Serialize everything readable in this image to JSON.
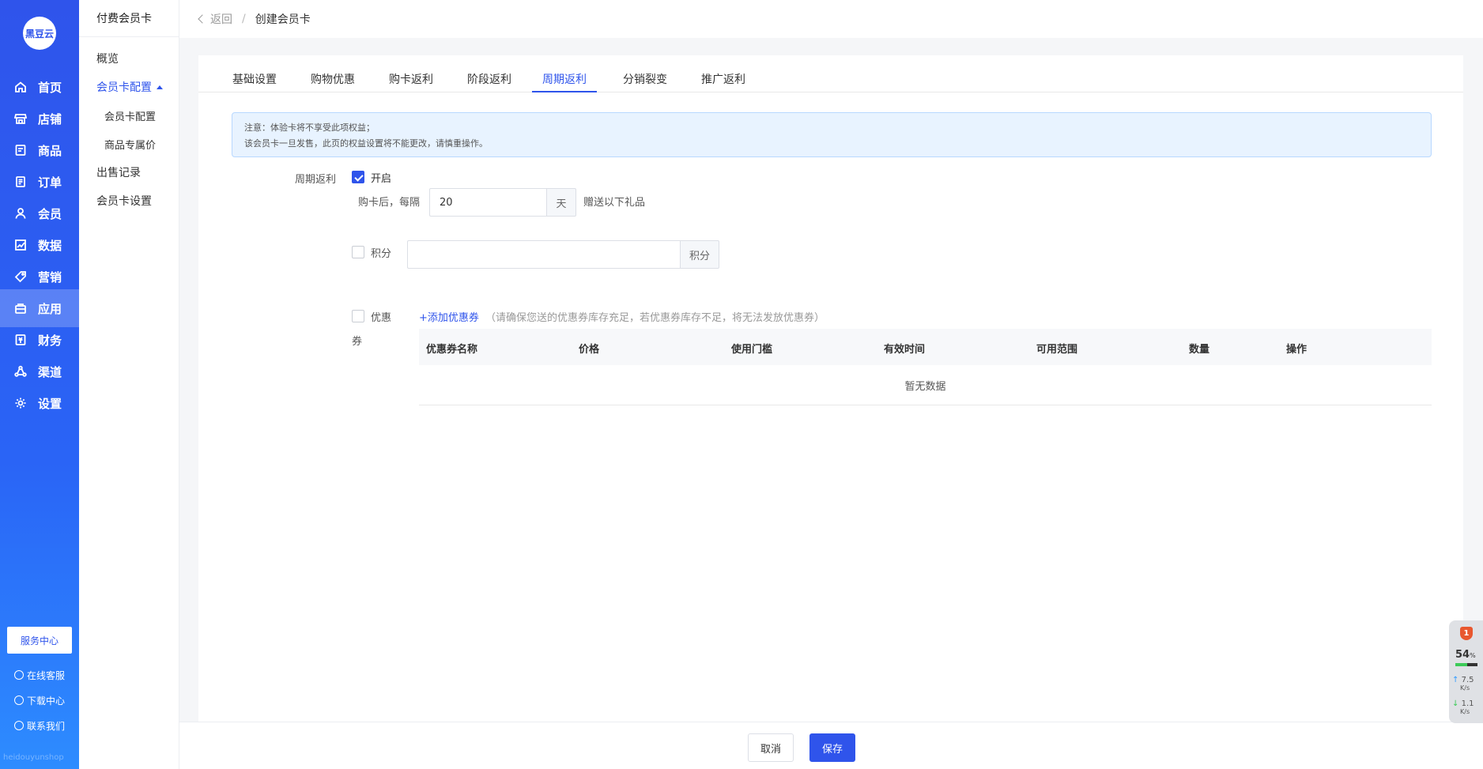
{
  "nav": {
    "logo": "黑豆云",
    "items": [
      {
        "label": "首页",
        "icon": "home-icon"
      },
      {
        "label": "店铺",
        "icon": "store-icon"
      },
      {
        "label": "商品",
        "icon": "goods-icon"
      },
      {
        "label": "订单",
        "icon": "order-icon"
      },
      {
        "label": "会员",
        "icon": "member-icon"
      },
      {
        "label": "数据",
        "icon": "chart-icon"
      },
      {
        "label": "营销",
        "icon": "tag-icon"
      },
      {
        "label": "应用",
        "icon": "app-icon"
      },
      {
        "label": "财务",
        "icon": "finance-icon"
      },
      {
        "label": "渠道",
        "icon": "channel-icon"
      },
      {
        "label": "设置",
        "icon": "gear-icon"
      }
    ],
    "active": "应用",
    "service_center": "服务中心",
    "links": [
      "在线客服",
      "下载中心",
      "联系我们"
    ],
    "footer": "heidouyunshop"
  },
  "submenu": {
    "title": "付费会员卡",
    "items": {
      "overview": "概览",
      "config_parent": "会员卡配置",
      "config_child": "会员卡配置",
      "exclusive_price": "商品专属价",
      "sales_record": "出售记录",
      "card_settings": "会员卡设置"
    }
  },
  "breadcrumb": {
    "back": "返回",
    "separator": "/",
    "current": "创建会员卡"
  },
  "tabs": [
    "基础设置",
    "购物优惠",
    "购卡返利",
    "阶段返利",
    "周期返利",
    "分销裂变",
    "推广返利"
  ],
  "active_tab": "周期返利",
  "notice": {
    "line1": "注意：体验卡将不享受此项权益；",
    "line2": "该会员卡一旦发售，此页的权益设置将不能更改，请慎重操作。"
  },
  "form": {
    "label": "周期返利",
    "enable_label": "开启",
    "enabled": true,
    "interval_prefix": "购卡后，每隔",
    "interval_value": "20",
    "interval_unit": "天",
    "interval_suffix": "赠送以下礼品",
    "points_label": "积分",
    "points_checked": false,
    "points_value": "",
    "points_unit": "积分",
    "coupon_label_1": "优惠",
    "coupon_label_2": "券",
    "coupon_checked": false,
    "add_coupon": "+添加优惠券",
    "coupon_hint": "（请确保您送的优惠券库存充足，若优惠券库存不足，将无法发放优惠券）"
  },
  "coupon_table": {
    "columns": [
      "优惠券名称",
      "价格",
      "使用门槛",
      "有效时间",
      "可用范围",
      "数量",
      "操作"
    ],
    "rows": [],
    "empty_text": "暂无数据"
  },
  "footer": {
    "cancel": "取消",
    "save": "保存"
  },
  "monitor": {
    "badge": "1",
    "cpu_percent": "54",
    "cpu_unit": "%",
    "cpu_level": 0.54,
    "upload": "7.5",
    "download": "1.1",
    "rate_unit": "K/s"
  },
  "colors": {
    "primary": "#2f54eb",
    "notice_bg": "#e8f3ff",
    "badge_red": "#e8572f"
  }
}
